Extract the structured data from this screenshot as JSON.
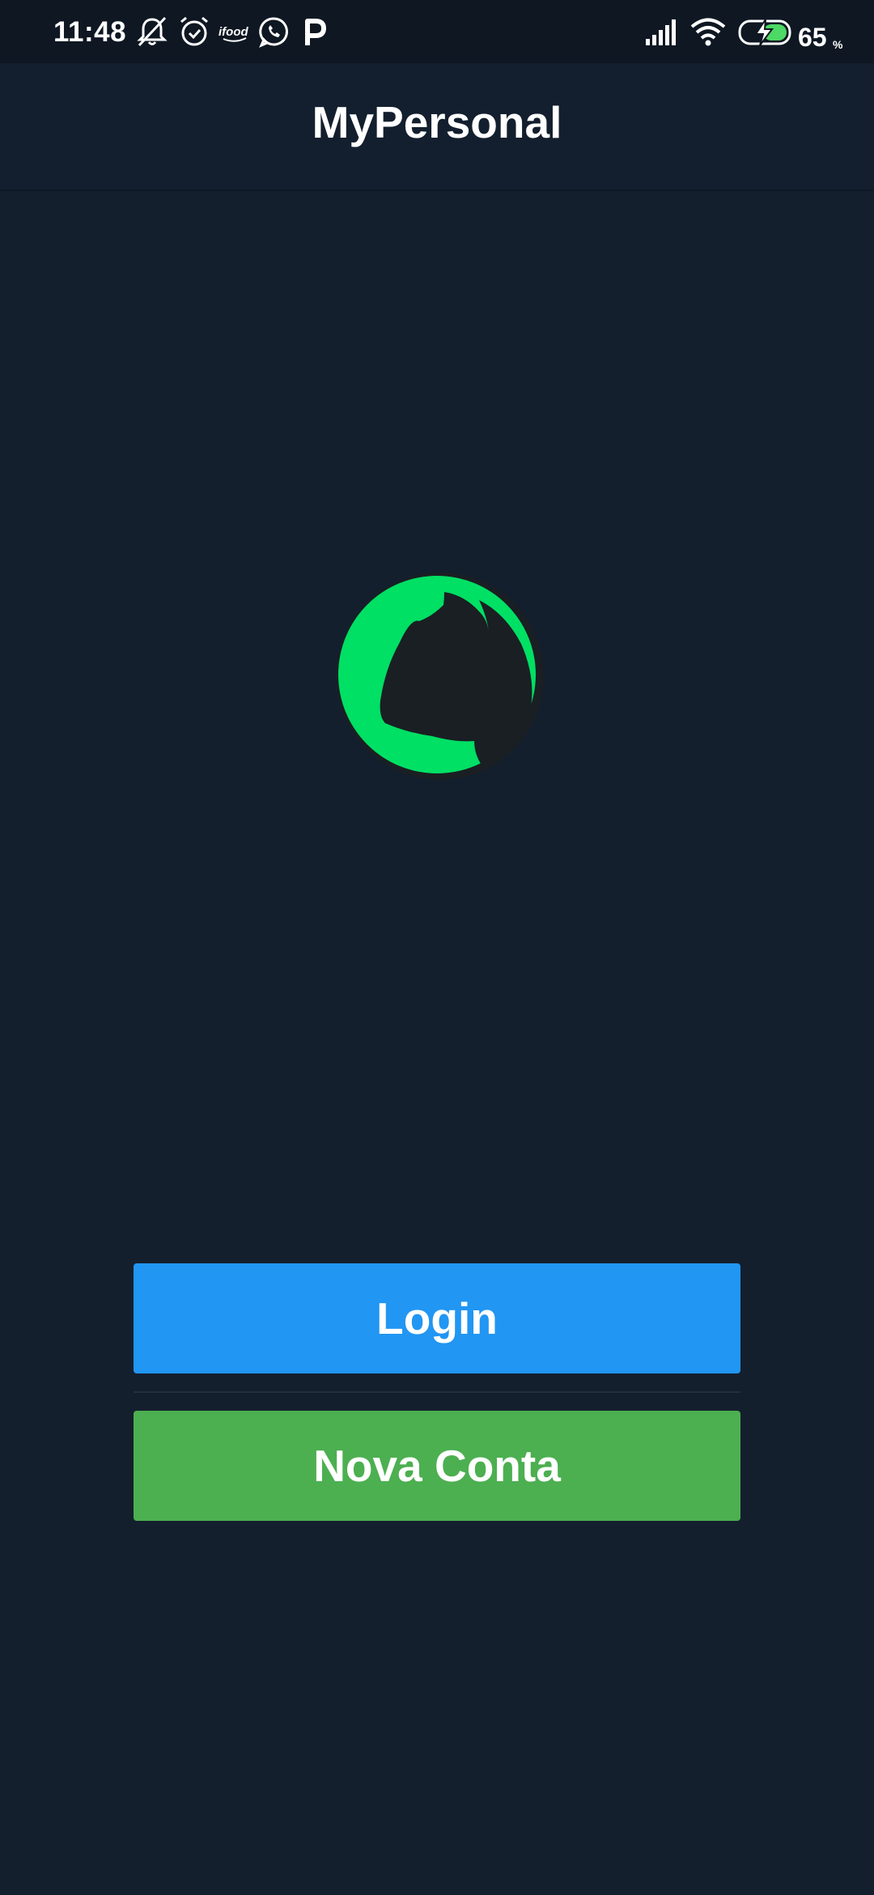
{
  "status_bar": {
    "time": "11:48",
    "icons": [
      "mute-bell-icon",
      "alarm-icon",
      "ifood-icon",
      "whatsapp-icon",
      "p-icon"
    ],
    "right_icons": [
      "signal-icon",
      "wifi-icon",
      "battery-charging-icon"
    ],
    "battery_level": "65",
    "battery_unit": "%"
  },
  "app_bar": {
    "title": "MyPersonal"
  },
  "logo": {
    "icon": "flexed-arm-icon",
    "accent_color": "#00e064",
    "dark_color": "#1a1f23"
  },
  "actions": {
    "login_label": "Login",
    "new_account_label": "Nova Conta"
  },
  "colors": {
    "background": "#141f2e",
    "login_button": "#2196f3",
    "new_account_button": "#4caf50"
  }
}
